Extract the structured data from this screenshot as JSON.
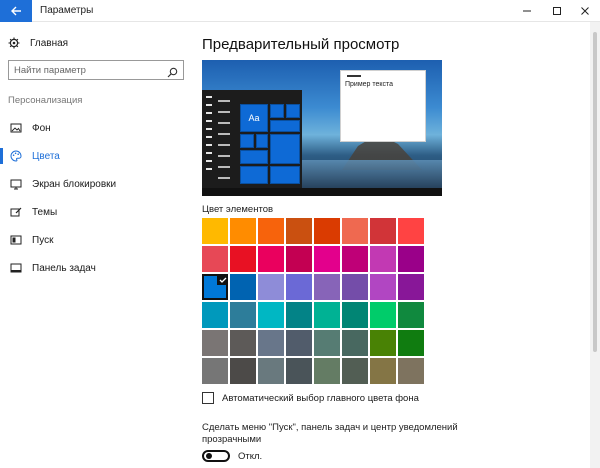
{
  "window": {
    "title": "Параметры"
  },
  "sidebar": {
    "home_label": "Главная",
    "search_placeholder": "Найти параметр",
    "section_label": "Персонализация",
    "items": [
      {
        "label": "Фон",
        "icon": "image-icon",
        "active": false
      },
      {
        "label": "Цвета",
        "icon": "palette-icon",
        "active": true
      },
      {
        "label": "Экран блокировки",
        "icon": "lock-screen-icon",
        "active": false
      },
      {
        "label": "Темы",
        "icon": "brush-icon",
        "active": false
      },
      {
        "label": "Пуск",
        "icon": "start-icon",
        "active": false
      },
      {
        "label": "Панель задач",
        "icon": "taskbar-icon",
        "active": false
      }
    ]
  },
  "main": {
    "title": "Предварительный просмотр",
    "preview": {
      "tile_text": "Aa",
      "sample_text": "Пример текста"
    },
    "colors_title": "Цвет элементов",
    "accent_colors": [
      "#FFB900",
      "#FF8C00",
      "#F7630C",
      "#CA5010",
      "#DA3B01",
      "#EF6950",
      "#D13438",
      "#FF4343",
      "#E74856",
      "#E81123",
      "#EA005E",
      "#C30052",
      "#E3008C",
      "#BF0077",
      "#C239B3",
      "#9A0089",
      "#0078D7",
      "#0063B1",
      "#8E8CD8",
      "#6B69D6",
      "#8764B8",
      "#744DA9",
      "#B146C2",
      "#881798",
      "#0099BC",
      "#2D7D9A",
      "#00B7C3",
      "#038387",
      "#00B294",
      "#018574",
      "#00CC6A",
      "#10893E",
      "#7A7574",
      "#5D5A58",
      "#68768A",
      "#515C6B",
      "#567C73",
      "#486860",
      "#498205",
      "#107C10",
      "#767676",
      "#4C4A48",
      "#69797E",
      "#4A5459",
      "#647C64",
      "#525E54",
      "#847545",
      "#7E735F"
    ],
    "selected_color_index": 16,
    "auto_color_label": "Автоматический выбор главного цвета фона",
    "auto_color_checked": false,
    "transparency_label": "Сделать меню \"Пуск\", панель задач и центр уведомлений прозрачными",
    "transparency_toggle_label": "Откл.",
    "transparency_on": false
  }
}
